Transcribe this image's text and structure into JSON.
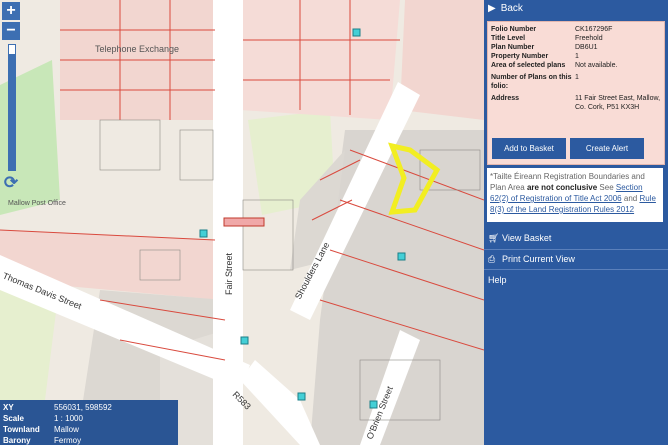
{
  "map": {
    "zoom_in_label": "+",
    "zoom_out_label": "−",
    "refresh_glyph": "⟳",
    "zoom_level_fraction": 0.93,
    "street_labels": {
      "fair_street": "Fair Street",
      "shoulders_lane": "Shoulders Lane",
      "thomas_davis_street": "Thomas Davis Street",
      "r583": "R583",
      "o_brien_street": "O'Brien Street",
      "telephone_exchange": "Telephone Exchange",
      "post_office": "Mallow Post Office"
    },
    "colors": {
      "highlight": "#f2ee22",
      "parcel": "#d94a3e",
      "marker": "#44cfd6",
      "road": "#ffffff",
      "green": "#c8e7b8"
    }
  },
  "info_box": {
    "rows": [
      {
        "key": "XY",
        "value": "556031, 598592"
      },
      {
        "key": "Scale",
        "value": "1 : 1000"
      },
      {
        "key": "Townland",
        "value": "Mallow"
      },
      {
        "key": "Barony",
        "value": "Fermoy"
      }
    ]
  },
  "panel": {
    "back_label": "Back",
    "back_glyph": "▶",
    "properties": [
      {
        "key": "Folio Number",
        "value": "CK167296F"
      },
      {
        "key": "Title Level",
        "value": "Freehold"
      },
      {
        "key": "Plan Number",
        "value": "DB6U1"
      },
      {
        "key": "Property Number",
        "value": "1"
      },
      {
        "key": "Area of selected plans",
        "value": "Not available."
      },
      {
        "key": "Number of Plans on this folio:",
        "value": "1"
      },
      {
        "key": "Address",
        "value": "11 Fair Street East, Mallow, Co. Cork, P51 KX3H"
      }
    ],
    "add_to_basket": "Add to Basket",
    "create_alert": "Create Alert",
    "note": {
      "prefix": "*Tailte Éireann Registration Boundaries and Plan Area",
      "bold": "are not conclusive",
      "see": "See",
      "link1": "Section 62(2) of Registration of Title Act 2006",
      "and": "and",
      "link2": "Rule 8(3) of the Land Registration Rules 2012"
    },
    "view_basket": "View Basket",
    "print_view": "Print Current View",
    "help": "Help"
  }
}
